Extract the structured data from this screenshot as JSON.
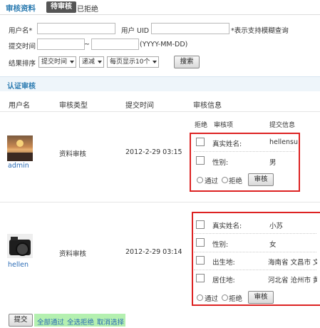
{
  "header": {
    "title": "审核资料",
    "tab_active": "待审核",
    "tab_other": "已拒绝"
  },
  "search": {
    "username_label": "用户名*",
    "uid_label": "用户 UID",
    "fuzzy_hint": "*表示支持模糊查询",
    "submit_time_label": "提交时间",
    "range_sep": "~",
    "date_format": "(YYYY-MM-DD)",
    "sort_label": "结果排序",
    "sort_field": "提交时间",
    "sort_order": "递减",
    "page_size": "每页显示10个",
    "search_button": "搜索"
  },
  "section": {
    "title": "认证审核"
  },
  "table": {
    "headers": [
      "用户名",
      "审核类型",
      "提交时间",
      "审核信息"
    ],
    "sub_headers": [
      "拒绝",
      "审核项",
      "提交信息"
    ]
  },
  "records": [
    {
      "username": "admin",
      "type": "资料审核",
      "time": "2012-2-29 03:15",
      "items": [
        {
          "label": "真实姓名:",
          "value": "hellensu"
        },
        {
          "label": "性别:",
          "value": "男"
        }
      ],
      "pass_label": "通过",
      "reject_label": "拒绝",
      "audit_button": "审核"
    },
    {
      "username": "hellen",
      "type": "资料审核",
      "time": "2012-2-29 03:14",
      "items": [
        {
          "label": "真实姓名:",
          "value": "小苏"
        },
        {
          "label": "性别:",
          "value": "女"
        },
        {
          "label": "出生地:",
          "value": "海南省 文昌市 文"
        },
        {
          "label": "居住地:",
          "value": "河北省 沧州市 黄"
        }
      ],
      "pass_label": "通过",
      "reject_label": "拒绝",
      "audit_button": "审核"
    }
  ],
  "footer": {
    "submit_button": "提交",
    "pass_all": "全部通过",
    "reject_all": "全选拒绝",
    "clear_all": "取消选择"
  }
}
